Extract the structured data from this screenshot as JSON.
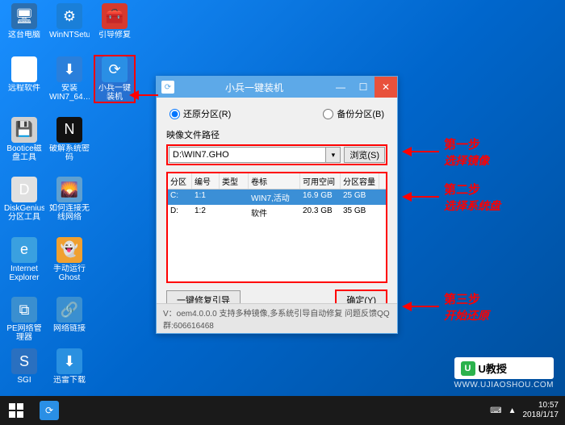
{
  "desktop_icons": [
    {
      "label": "这台电脑",
      "bg": "#2b6fb0",
      "glyph": "🖥"
    },
    {
      "label": "WinNTSetup",
      "bg": "#1a7fd8",
      "glyph": "⚙"
    },
    {
      "label": "引导修复",
      "bg": "#d63a2e",
      "glyph": "🧰"
    },
    {
      "label": "远程软件",
      "bg": "#ffffff",
      "glyph": "☁"
    },
    {
      "label": "安装WIN7_64…",
      "bg": "#2a7fdb",
      "glyph": "⬇"
    },
    {
      "label": "小兵一键装机",
      "bg": "#2a8fe5",
      "glyph": "⟳",
      "hl": true
    },
    {
      "label": "Bootice磁盘工具",
      "bg": "#d0d0d0",
      "glyph": "💾"
    },
    {
      "label": "破解系统密码",
      "bg": "#111111",
      "glyph": "N"
    },
    {
      "label": "",
      "bg": "",
      "glyph": ""
    },
    {
      "label": "DiskGenius分区工具",
      "bg": "#e0e0e0",
      "glyph": "D"
    },
    {
      "label": "如何连接无线网络",
      "bg": "#5fa0d0",
      "glyph": "🌄"
    },
    {
      "label": "",
      "bg": "",
      "glyph": ""
    },
    {
      "label": "Internet Explorer",
      "bg": "#3aa0e0",
      "glyph": "e"
    },
    {
      "label": "手动运行Ghost",
      "bg": "#f0a030",
      "glyph": "👻"
    },
    {
      "label": "",
      "bg": "",
      "glyph": ""
    },
    {
      "label": "PE网络管理器",
      "bg": "#3a8fd0",
      "glyph": "⧉"
    },
    {
      "label": "网络链接",
      "bg": "#3a8fd0",
      "glyph": "🔗"
    },
    {
      "label": "",
      "bg": "",
      "glyph": ""
    },
    {
      "label": "SGI",
      "bg": "#2a70c0",
      "glyph": "S"
    },
    {
      "label": "迅雷下载",
      "bg": "#2a90e0",
      "glyph": "⬇"
    }
  ],
  "window": {
    "title": "小兵一键装机",
    "restore_label": "还原分区(R)",
    "backup_label": "备份分区(B)",
    "path_label": "映像文件路径",
    "path_value": "D:\\WIN7.GHO",
    "browse_label": "浏览(S)",
    "columns": [
      "分区",
      "编号",
      "类型",
      "卷标",
      "可用空间",
      "分区容量"
    ],
    "rows": [
      {
        "p": "C:",
        "n": "1:1",
        "t": "",
        "l": "WIN7,活动",
        "f": "16.9 GB",
        "c": "25 GB",
        "selected": true
      },
      {
        "p": "D:",
        "n": "1:2",
        "t": "",
        "l": "软件",
        "f": "20.3 GB",
        "c": "35 GB",
        "selected": false
      }
    ],
    "repair_label": "一键修复引导",
    "ok_label": "确定(Y)",
    "version": "V：oem4.0.0.0       支持多种镜像,多系统引导自动修复 问题反馈QQ群:606616468"
  },
  "annotations": {
    "step1_title": "第一步",
    "step1_sub": "选择镜像",
    "step2_title": "第二步",
    "step2_sub": "选择系统盘",
    "step3_title": "第三步",
    "step3_sub": "开始还原"
  },
  "taskbar": {
    "time": "10:57",
    "date": "2018/1/17"
  },
  "watermark": {
    "brand": "U教授",
    "url": "WWW.UJIAOSHOU.COM"
  }
}
